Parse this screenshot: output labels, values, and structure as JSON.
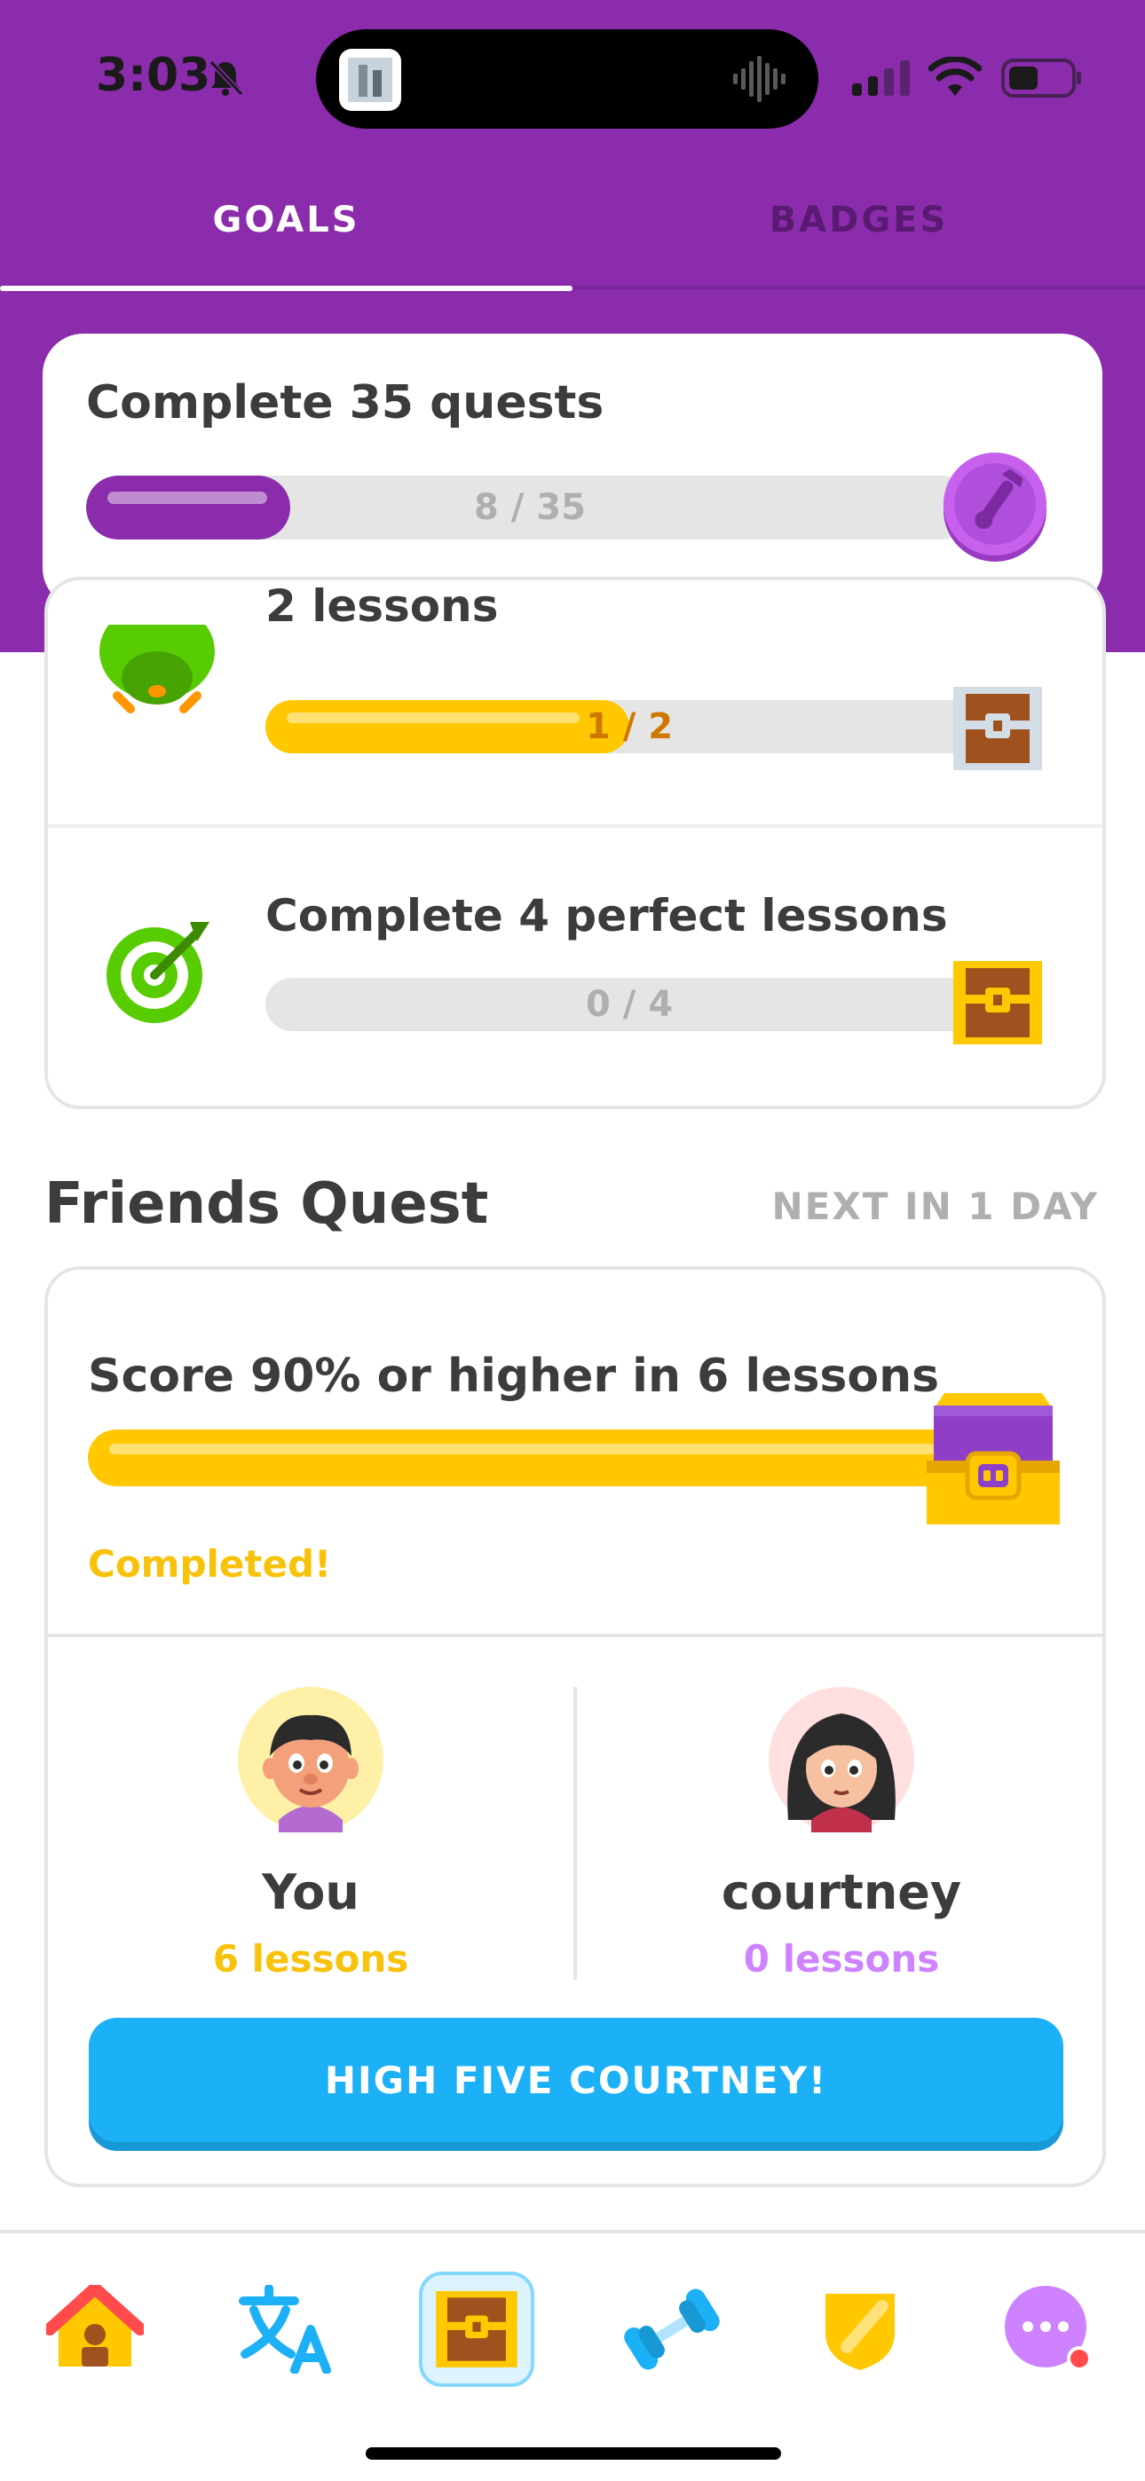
{
  "status_bar": {
    "time": "3:03"
  },
  "tabs": [
    {
      "label": "GOALS",
      "active": true
    },
    {
      "label": "BADGES",
      "active": false
    }
  ],
  "monthly_quest": {
    "title": "Complete 35 quests",
    "progress_label": "8 / 35",
    "progress": 0.23,
    "badge_icon": "trumpet-badge-icon"
  },
  "daily_quests": [
    {
      "title": "2 lessons",
      "progress_label": "1 / 2",
      "progress": 0.5,
      "icon": "owl-icon",
      "reward_icon": "silver-chest-icon"
    },
    {
      "title": "Complete 4 perfect lessons",
      "progress_label": "0 / 4",
      "progress": 0.0,
      "icon": "target-icon",
      "reward_icon": "gold-chest-icon"
    }
  ],
  "friends_quest": {
    "section_title": "Friends Quest",
    "next_in": "NEXT IN 1 DAY",
    "title": "Score 90% or higher in 6 lessons",
    "progress": 1.0,
    "status": "Completed!",
    "participants": [
      {
        "name": "You",
        "lessons": "6 lessons",
        "color": "#f8c20a"
      },
      {
        "name": "courtney",
        "lessons": "0 lessons",
        "color": "#ce82ff"
      }
    ],
    "button_label": "HIGH FIVE COURTNEY!"
  },
  "bottom_nav": [
    {
      "icon": "home-icon",
      "active": false
    },
    {
      "icon": "translate-icon",
      "active": false
    },
    {
      "icon": "quests-chest-icon",
      "active": true
    },
    {
      "icon": "dumbbell-icon",
      "active": false
    },
    {
      "icon": "shield-icon",
      "active": false
    },
    {
      "icon": "more-icon",
      "active": false,
      "notification_dot": true
    }
  ],
  "colors": {
    "header_purple": "#8a2cab",
    "progress_purple": "#8a2cab",
    "progress_yellow": "#ffc800",
    "button_blue": "#1cb0f6"
  }
}
